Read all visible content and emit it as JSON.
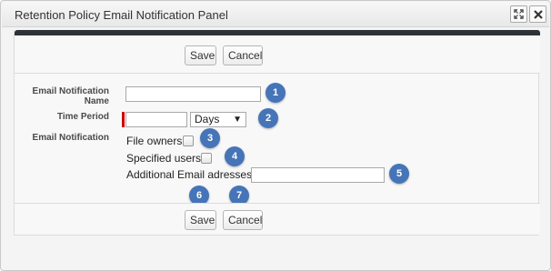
{
  "window": {
    "title": "Retention Policy Email Notification Panel",
    "expand_icon": "expand-icon",
    "close_icon": "close-icon"
  },
  "toolbar_top": {
    "save_label": "Save",
    "cancel_label": "Cancel"
  },
  "toolbar_bottom": {
    "save_label": "Save",
    "cancel_label": "Cancel"
  },
  "form": {
    "name_label_line1": "Email Notification",
    "name_label_line2": "Name",
    "name_value": "",
    "time_period_label": "Time Period",
    "time_period_value": "",
    "time_unit_selected": "Days",
    "email_notification_label": "Email Notification",
    "file_owners_label": "File owners",
    "file_owners_checked": false,
    "specified_users_label": "Specified users",
    "specified_users_checked": false,
    "additional_email_label": "Additional Email adresses:",
    "additional_email_value": ""
  },
  "callouts": [
    "1",
    "2",
    "3",
    "4",
    "5",
    "6",
    "7"
  ],
  "colors": {
    "callout": "#4674b8",
    "header_bar": "#2d3238",
    "required_marker": "#cc0000"
  }
}
